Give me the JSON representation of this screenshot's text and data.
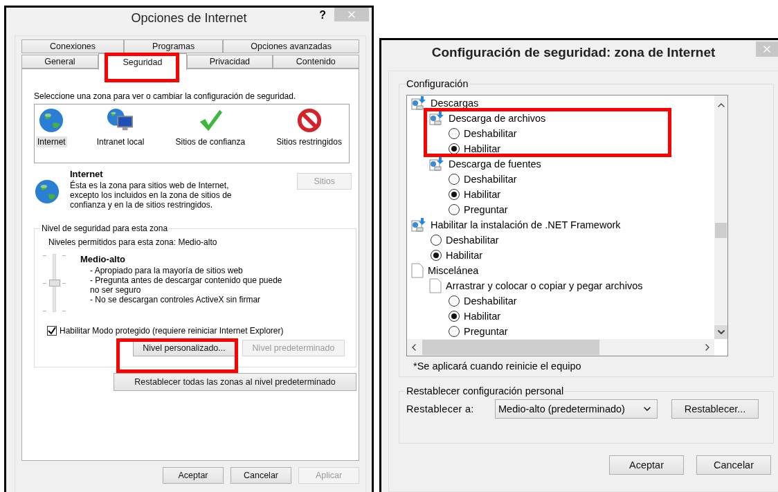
{
  "left_dialog": {
    "title": "Opciones de Internet",
    "help": "?",
    "tab_rows": [
      {
        "tabs": [
          {
            "label": "Conexiones",
            "selected": false
          },
          {
            "label": "Programas",
            "selected": false
          },
          {
            "label": "Opciones avanzadas",
            "selected": false
          }
        ]
      },
      {
        "tabs": [
          {
            "label": "General",
            "selected": false
          },
          {
            "label": "Seguridad",
            "selected": true
          },
          {
            "label": "Privacidad",
            "selected": false
          },
          {
            "label": "Contenido",
            "selected": false
          }
        ]
      }
    ],
    "zone_prompt": "Seleccione una zona para ver o cambiar la configuración de seguridad.",
    "zones": [
      {
        "label": "Internet",
        "kind": "globe",
        "selected": true
      },
      {
        "label": "Intranet local",
        "kind": "intranet",
        "selected": false
      },
      {
        "label": "Sitios de confianza",
        "kind": "check",
        "selected": false
      },
      {
        "label": "Sitios restringidos",
        "kind": "blocked",
        "selected": false
      }
    ],
    "zone_info": {
      "title": "Internet",
      "description": "Ésta es la zona para sitios web de Internet, excepto los incluidos en la zona de sitios de confianza y en la de sitios restringidos.",
      "sites_button": {
        "label": "Sitios",
        "disabled": true
      }
    },
    "security_level": {
      "legend": "Nivel de seguridad para esta zona",
      "allowed": "Niveles permitidos para esta zona: Medio-alto",
      "slider": {
        "level": 0.5
      },
      "level_name": "Medio-alto",
      "bullets": [
        "- Apropiado para la mayoría de sitios web",
        "- Pregunta antes de descargar contenido que puede no ser seguro",
        "- No se descargan controles ActiveX sin firmar"
      ],
      "protected_mode": {
        "label": "Habilitar Modo protegido (requiere reiniciar Internet Explorer)",
        "checked": true
      },
      "buttons": [
        {
          "label": "Nivel personalizado...",
          "disabled": false
        },
        {
          "label": "Nivel predeterminado",
          "disabled": true
        }
      ]
    },
    "reset_all_button": {
      "label": "Restablecer todas las zonas al nivel predeterminado",
      "disabled": false
    },
    "footer_buttons": [
      {
        "label": "Aceptar",
        "disabled": false
      },
      {
        "label": "Cancelar",
        "disabled": false
      },
      {
        "label": "Aplicar",
        "disabled": true
      }
    ]
  },
  "right_dialog": {
    "title": "Configuración de seguridad: zona de Internet",
    "settings_legend": "Configuración",
    "tree": [
      {
        "label": "Descargas",
        "kind": "download",
        "children": [
          {
            "label": "Descarga de archivos",
            "kind": "download",
            "options": [
              {
                "label": "Deshabilitar",
                "selected": false
              },
              {
                "label": "Habilitar",
                "selected": true
              }
            ]
          },
          {
            "label": "Descarga de fuentes",
            "kind": "download",
            "options": [
              {
                "label": "Deshabilitar",
                "selected": false
              },
              {
                "label": "Habilitar",
                "selected": true
              },
              {
                "label": "Preguntar",
                "selected": false
              }
            ]
          }
        ]
      },
      {
        "label": "Habilitar la instalación de .NET Framework",
        "kind": "download",
        "options": [
          {
            "label": "Deshabilitar",
            "selected": false
          },
          {
            "label": "Habilitar",
            "selected": true
          }
        ]
      },
      {
        "label": "Miscelánea",
        "kind": "page",
        "children": [
          {
            "label": "Arrastrar y colocar o copiar y pegar archivos",
            "kind": "page",
            "options": [
              {
                "label": "Deshabilitar",
                "selected": false
              },
              {
                "label": "Habilitar",
                "selected": true
              },
              {
                "label": "Preguntar",
                "selected": false
              }
            ]
          }
        ]
      }
    ],
    "note": "*Se aplicará cuando reinicie el equipo",
    "reset": {
      "legend": "Restablecer configuración personal",
      "field_label": "Restablecer a:",
      "value": "Medio-alto (predeterminado)",
      "button": "Restablecer..."
    },
    "footer_buttons": [
      {
        "label": "Aceptar",
        "disabled": false
      },
      {
        "label": "Cancelar",
        "disabled": false
      }
    ]
  }
}
